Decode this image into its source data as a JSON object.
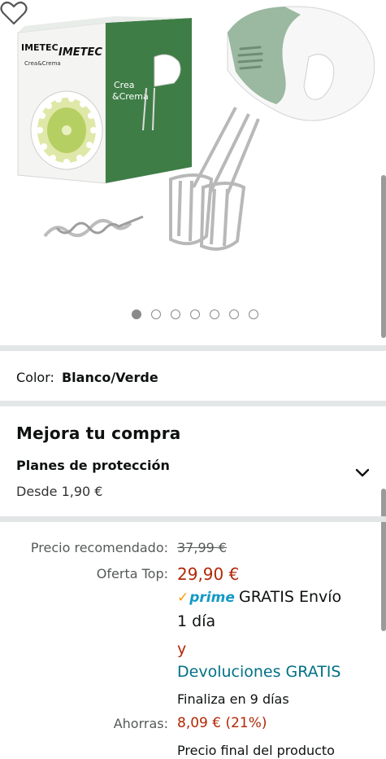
{
  "product_image": {
    "box_brand_left": "IMETEC",
    "box_brand_right": "IMETEC",
    "box_subtitle": "Crea&Crema",
    "box_product_name_line1": "Crea",
    "box_product_name_line2": "&Crema",
    "box_colors": {
      "green": "#3f7d47",
      "white": "#ffffff",
      "mixer_green": "#9bb8a0"
    }
  },
  "gallery": {
    "dot_count": 7,
    "active_index": 0
  },
  "color": {
    "label": "Color:",
    "value": "Blanco/Verde"
  },
  "upgrade": {
    "title": "Mejora tu compra",
    "plan_title": "Planes de protección",
    "plan_from": "Desde 1,90 €"
  },
  "pricing": {
    "recommended_label": "Precio recomendado:",
    "recommended_value": "37,99 €",
    "offer_label": "Oferta Top:",
    "offer_value": "29,90 €",
    "prime_label": "prime",
    "shipping_line1": "GRATIS Envío",
    "shipping_line2": "1 día",
    "and": "y",
    "returns": "Devoluciones GRATIS",
    "ends": "Finaliza en 9 días",
    "savings_label": "Ahorras:",
    "savings_value": "8,09 € (21%)",
    "final_price": "Precio final del producto"
  },
  "colors": {
    "price_red": "#b12704",
    "link_teal": "#007185",
    "prime_blue": "#1399c6",
    "divider": "#e3e6e6"
  }
}
